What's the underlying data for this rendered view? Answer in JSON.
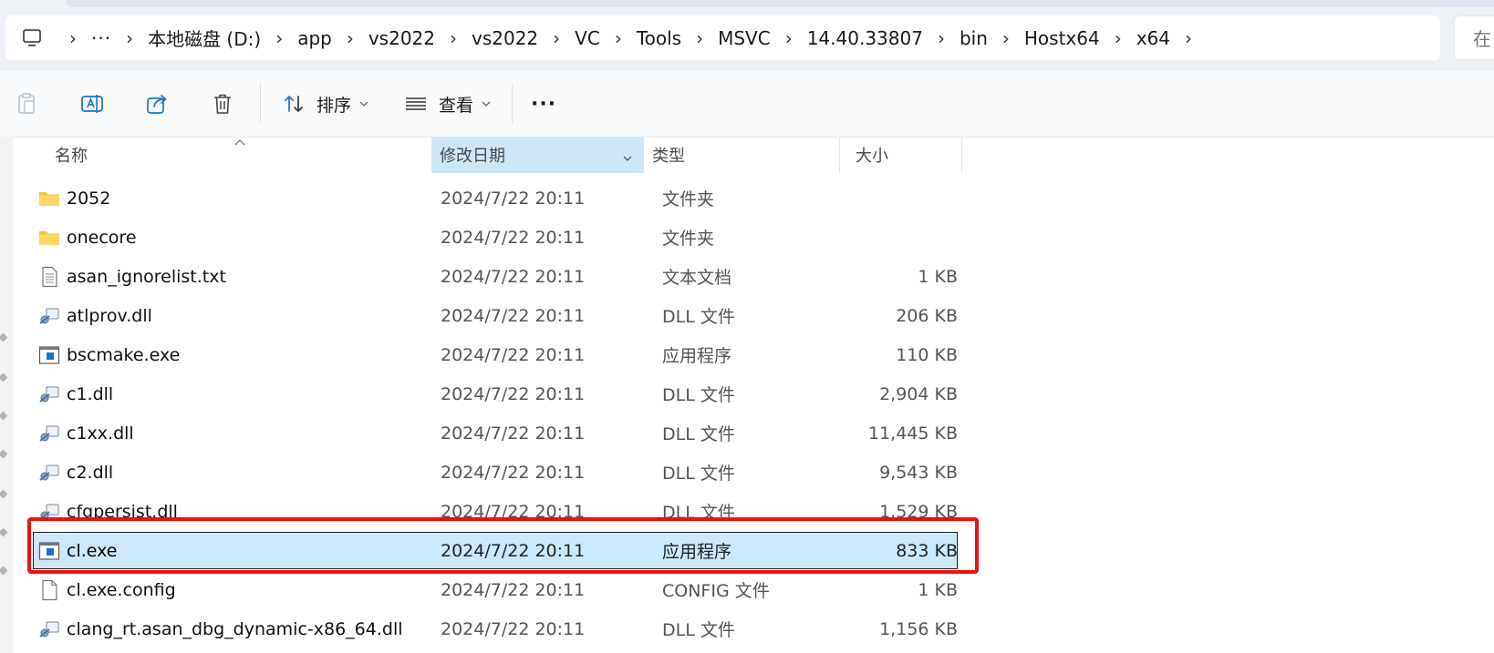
{
  "addressbar": {
    "overflow_label": "···",
    "crumbs": [
      "本地磁盘 (D:)",
      "app",
      "vs2022",
      "vs2022",
      "VC",
      "Tools",
      "MSVC",
      "14.40.33807",
      "bin",
      "Hostx64",
      "x64"
    ],
    "search_partial": "在"
  },
  "toolbar": {
    "sort_label": "排序",
    "view_label": "查看",
    "more_label": "···"
  },
  "columns": {
    "name": "名称",
    "date": "修改日期",
    "type": "类型",
    "size": "大小"
  },
  "files": [
    {
      "name": "2052",
      "date": "2024/7/22 20:11",
      "type": "文件夹",
      "size": "",
      "icon": "folder-icon"
    },
    {
      "name": "onecore",
      "date": "2024/7/22 20:11",
      "type": "文件夹",
      "size": "",
      "icon": "folder-icon"
    },
    {
      "name": "asan_ignorelist.txt",
      "date": "2024/7/22 20:11",
      "type": "文本文档",
      "size": "1 KB",
      "icon": "text-file-icon"
    },
    {
      "name": "atlprov.dll",
      "date": "2024/7/22 20:11",
      "type": "DLL 文件",
      "size": "206 KB",
      "icon": "dll-file-icon"
    },
    {
      "name": "bscmake.exe",
      "date": "2024/7/22 20:11",
      "type": "应用程序",
      "size": "110 KB",
      "icon": "exe-file-icon"
    },
    {
      "name": "c1.dll",
      "date": "2024/7/22 20:11",
      "type": "DLL 文件",
      "size": "2,904 KB",
      "icon": "dll-file-icon"
    },
    {
      "name": "c1xx.dll",
      "date": "2024/7/22 20:11",
      "type": "DLL 文件",
      "size": "11,445 KB",
      "icon": "dll-file-icon"
    },
    {
      "name": "c2.dll",
      "date": "2024/7/22 20:11",
      "type": "DLL 文件",
      "size": "9,543 KB",
      "icon": "dll-file-icon"
    },
    {
      "name": "cfgpersist.dll",
      "date": "2024/7/22 20:11",
      "type": "DLL 文件",
      "size": "1,529 KB",
      "icon": "dll-file-icon"
    },
    {
      "name": "cl.exe",
      "date": "2024/7/22 20:11",
      "type": "应用程序",
      "size": "833 KB",
      "icon": "exe-file-icon",
      "selected": true
    },
    {
      "name": "cl.exe.config",
      "date": "2024/7/22 20:11",
      "type": "CONFIG 文件",
      "size": "1 KB",
      "icon": "config-file-icon"
    },
    {
      "name": "clang_rt.asan_dbg_dynamic-x86_64.dll",
      "date": "2024/7/22 20:11",
      "type": "DLL 文件",
      "size": "1,156 KB",
      "icon": "dll-file-icon"
    }
  ],
  "colors": {
    "selection": "#cce8fb",
    "highlight_border": "#ee1010",
    "sorted_header": "#cfe6f7",
    "accent_icon": "#1a73c7"
  }
}
